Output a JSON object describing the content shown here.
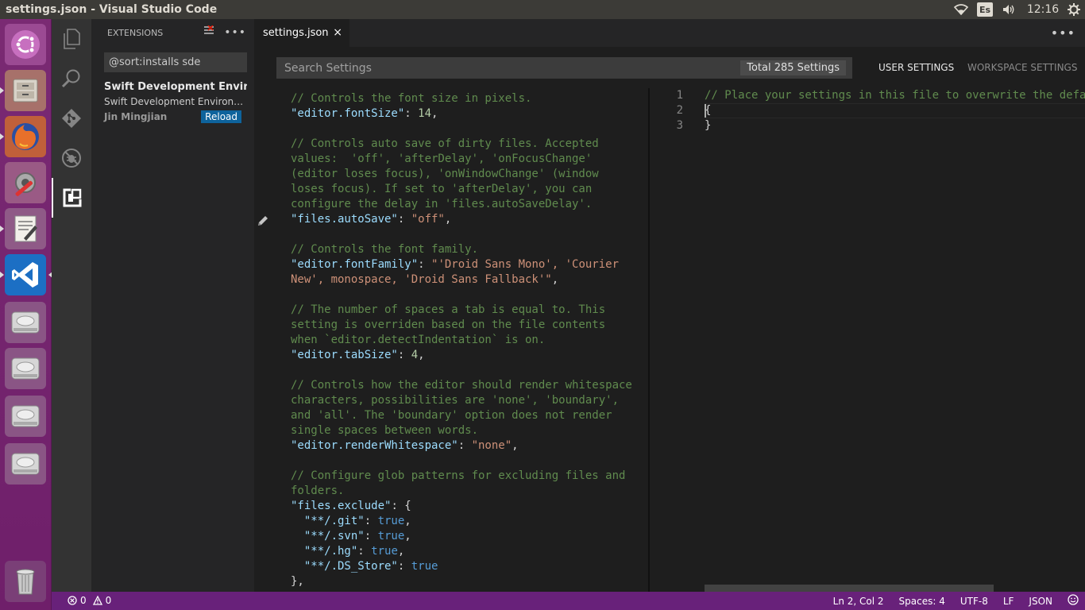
{
  "window": {
    "title": "settings.json - Visual Studio Code"
  },
  "panel": {
    "keyboard_layout": "Es",
    "time": "12:16"
  },
  "launcher": {
    "items": [
      {
        "name": "ubuntu-dash-icon"
      },
      {
        "name": "files-icon"
      },
      {
        "name": "firefox-icon"
      },
      {
        "name": "system-settings-icon"
      },
      {
        "name": "text-editor-icon"
      },
      {
        "name": "vscode-icon"
      },
      {
        "name": "drive-icon"
      },
      {
        "name": "drive-icon"
      },
      {
        "name": "drive-icon"
      },
      {
        "name": "drive-icon"
      },
      {
        "name": "trash-icon"
      }
    ]
  },
  "sidebar": {
    "title": "EXTENSIONS",
    "search_value": "@sort:installs sde",
    "extension": {
      "name": "Swift Development Environment",
      "name_visible": "Swift Development Environm",
      "description": "Swift Development Environ…",
      "author": "Jin Mingjian",
      "action": "Reload"
    }
  },
  "tabs": [
    {
      "label": "settings.json",
      "close": "×"
    }
  ],
  "settings": {
    "search_placeholder": "Search Settings",
    "total": "Total 285 Settings",
    "user_tab": "USER SETTINGS",
    "workspace_tab": "WORKSPACE SETTINGS"
  },
  "default_settings_lines": [
    [
      {
        "t": "// Controls the font size in pixels.",
        "c": "comment"
      }
    ],
    [
      {
        "t": "\"editor.fontSize\"",
        "c": "key"
      },
      {
        "t": ": ",
        "c": "punc"
      },
      {
        "t": "14",
        "c": "num"
      },
      {
        "t": ",",
        "c": "punc"
      }
    ],
    [],
    [
      {
        "t": "// Controls auto save of dirty files. Accepted",
        "c": "comment"
      }
    ],
    [
      {
        "t": "values:  'off', 'afterDelay', 'onFocusChange'",
        "c": "comment"
      }
    ],
    [
      {
        "t": "(editor loses focus), 'onWindowChange' (window",
        "c": "comment"
      }
    ],
    [
      {
        "t": "loses focus). If set to 'afterDelay', you can",
        "c": "comment"
      }
    ],
    [
      {
        "t": "configure the delay in 'files.autoSaveDelay'.",
        "c": "comment"
      }
    ],
    [
      {
        "t": "\"files.autoSave\"",
        "c": "key"
      },
      {
        "t": ": ",
        "c": "punc"
      },
      {
        "t": "\"off\"",
        "c": "str"
      },
      {
        "t": ",",
        "c": "punc"
      }
    ],
    [],
    [
      {
        "t": "// Controls the font family.",
        "c": "comment"
      }
    ],
    [
      {
        "t": "\"editor.fontFamily\"",
        "c": "key"
      },
      {
        "t": ": ",
        "c": "punc"
      },
      {
        "t": "\"'Droid Sans Mono', 'Courier",
        "c": "str"
      }
    ],
    [
      {
        "t": "New', monospace, 'Droid Sans Fallback'\"",
        "c": "str"
      },
      {
        "t": ",",
        "c": "punc"
      }
    ],
    [],
    [
      {
        "t": "// The number of spaces a tab is equal to. This",
        "c": "comment"
      }
    ],
    [
      {
        "t": "setting is overriden based on the file contents",
        "c": "comment"
      }
    ],
    [
      {
        "t": "when `editor.detectIndentation` is on.",
        "c": "comment"
      }
    ],
    [
      {
        "t": "\"editor.tabSize\"",
        "c": "key"
      },
      {
        "t": ": ",
        "c": "punc"
      },
      {
        "t": "4",
        "c": "num"
      },
      {
        "t": ",",
        "c": "punc"
      }
    ],
    [],
    [
      {
        "t": "// Controls how the editor should render whitespace",
        "c": "comment"
      }
    ],
    [
      {
        "t": "characters, possibilities are 'none', 'boundary',",
        "c": "comment"
      }
    ],
    [
      {
        "t": "and 'all'. The 'boundary' option does not render",
        "c": "comment"
      }
    ],
    [
      {
        "t": "single spaces between words.",
        "c": "comment"
      }
    ],
    [
      {
        "t": "\"editor.renderWhitespace\"",
        "c": "key"
      },
      {
        "t": ": ",
        "c": "punc"
      },
      {
        "t": "\"none\"",
        "c": "str"
      },
      {
        "t": ",",
        "c": "punc"
      }
    ],
    [],
    [
      {
        "t": "// Configure glob patterns for excluding files and",
        "c": "comment"
      }
    ],
    [
      {
        "t": "folders.",
        "c": "comment"
      }
    ],
    [
      {
        "t": "\"files.exclude\"",
        "c": "key"
      },
      {
        "t": ": {",
        "c": "punc"
      }
    ],
    [
      {
        "t": "  \"**/.git\"",
        "c": "key"
      },
      {
        "t": ": ",
        "c": "punc"
      },
      {
        "t": "true",
        "c": "bool"
      },
      {
        "t": ",",
        "c": "punc"
      }
    ],
    [
      {
        "t": "  \"**/.svn\"",
        "c": "key"
      },
      {
        "t": ": ",
        "c": "punc"
      },
      {
        "t": "true",
        "c": "bool"
      },
      {
        "t": ",",
        "c": "punc"
      }
    ],
    [
      {
        "t": "  \"**/.hg\"",
        "c": "key"
      },
      {
        "t": ": ",
        "c": "punc"
      },
      {
        "t": "true",
        "c": "bool"
      },
      {
        "t": ",",
        "c": "punc"
      }
    ],
    [
      {
        "t": "  \"**/.DS_Store\"",
        "c": "key"
      },
      {
        "t": ": ",
        "c": "punc"
      },
      {
        "t": "true",
        "c": "bool"
      }
    ],
    [
      {
        "t": "},",
        "c": "punc"
      }
    ]
  ],
  "user_settings": {
    "line_numbers": [
      "1",
      "2",
      "3"
    ],
    "lines": [
      {
        "t": "// Place your settings in this file to overwrite the defa",
        "c": "comment"
      },
      {
        "t": "{",
        "c": "punc"
      },
      {
        "t": "}",
        "c": "punc"
      }
    ]
  },
  "statusbar": {
    "errors": "0",
    "warnings": "0",
    "position": "Ln 2, Col 2",
    "indent": "Spaces: 4",
    "encoding": "UTF-8",
    "eol": "LF",
    "language": "JSON"
  },
  "colors": {
    "launcher": "#7a2a73",
    "statusbar": "#68217a",
    "comment": "#608b4e",
    "key": "#9cdcfe",
    "string": "#ce9178",
    "number": "#b5cea8",
    "bool": "#569cd6",
    "reload_button": "#0e639c"
  }
}
